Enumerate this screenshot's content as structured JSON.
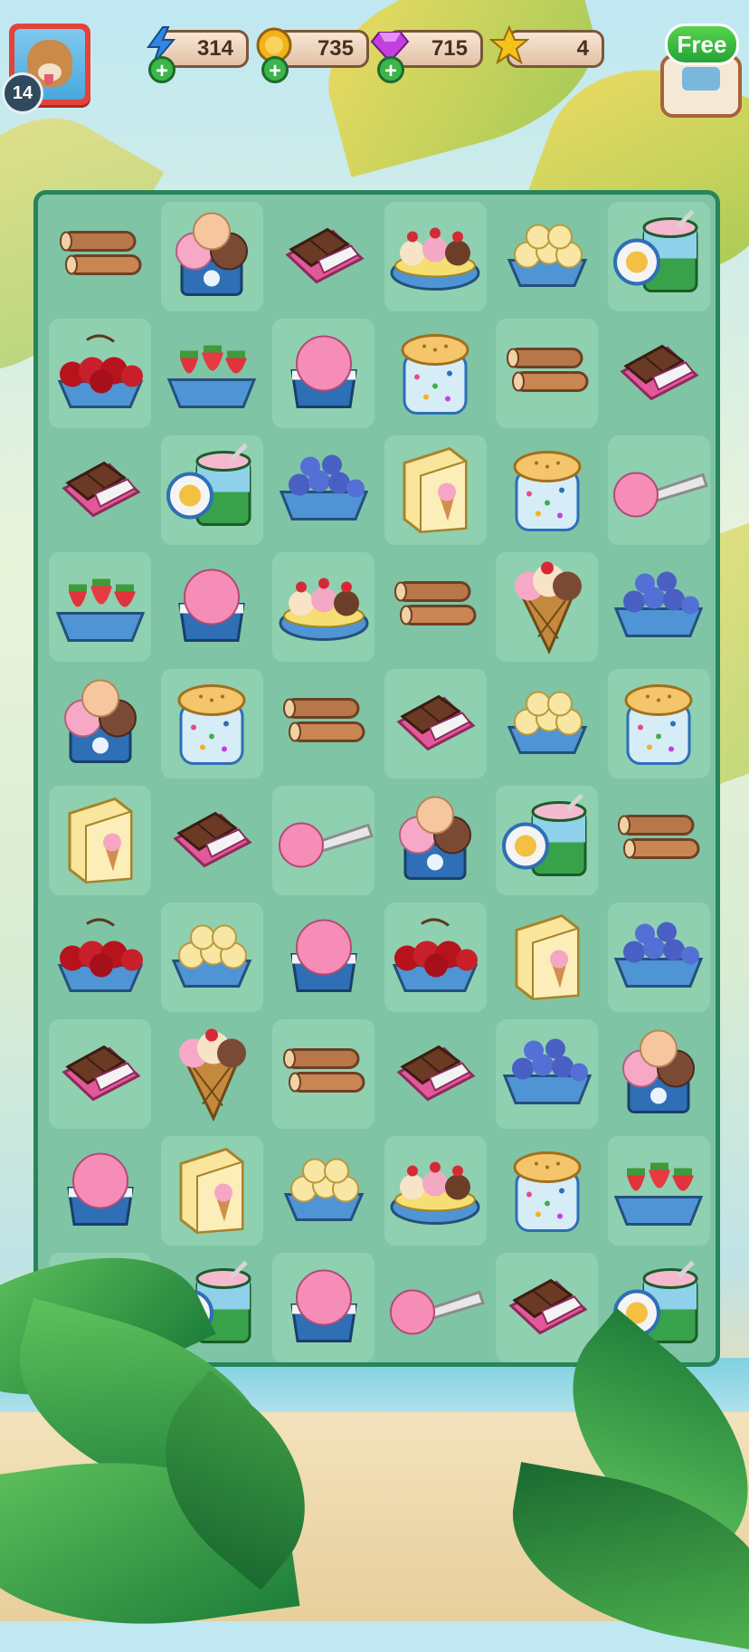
{
  "player": {
    "level": "14",
    "avatar_icon": "dog-avatar-icon"
  },
  "resources": [
    {
      "name": "energy",
      "icon": "lightning-icon",
      "value": "314",
      "color": "#2f86e6"
    },
    {
      "name": "coins",
      "icon": "coin-icon",
      "value": "735",
      "color": "#f2b21c"
    },
    {
      "name": "gems",
      "icon": "gem-icon",
      "value": "715",
      "color": "#c23fe0"
    },
    {
      "name": "stars",
      "icon": "star-icon",
      "value": "4",
      "color": "#f5c21c"
    }
  ],
  "free_gift": {
    "label": "Free",
    "icon": "gift-icon"
  },
  "board": {
    "rows": [
      [
        "wafer-roll",
        "ice-cream-cup",
        "chocolate-bar",
        "banana-split",
        "banana-slices",
        "yogurt-tub"
      ],
      [
        "cherries",
        "strawberries",
        "pink-scoop",
        "sprinkles-jar",
        "wafer-roll",
        "chocolate-bar"
      ],
      [
        "chocolate-bar",
        "yogurt-tub",
        "blueberries",
        "ice-cream-box",
        "sprinkles-jar",
        "ice-cream-scoop"
      ],
      [
        "strawberries",
        "pink-scoop",
        "banana-split",
        "wafer-roll",
        "waffle-cone",
        "blueberries"
      ],
      [
        "ice-cream-cup",
        "sprinkles-jar",
        "wafer-roll",
        "chocolate-bar",
        "banana-slices",
        "sprinkles-jar"
      ],
      [
        "ice-cream-box",
        "chocolate-bar",
        "ice-cream-scoop",
        "ice-cream-cup",
        "yogurt-tub",
        "wafer-roll"
      ],
      [
        "cherries",
        "banana-slices",
        "pink-scoop",
        "cherries",
        "ice-cream-box",
        "blueberries"
      ],
      [
        "chocolate-bar",
        "waffle-cone",
        "wafer-roll",
        "chocolate-bar",
        "blueberries",
        "ice-cream-cup"
      ],
      [
        "pink-scoop",
        "ice-cream-box",
        "banana-slices",
        "banana-split",
        "sprinkles-jar",
        "strawberries"
      ],
      [
        "chocolate-bar",
        "yogurt-tub",
        "pink-scoop",
        "ice-cream-scoop",
        "chocolate-bar",
        "yogurt-tub"
      ]
    ]
  }
}
